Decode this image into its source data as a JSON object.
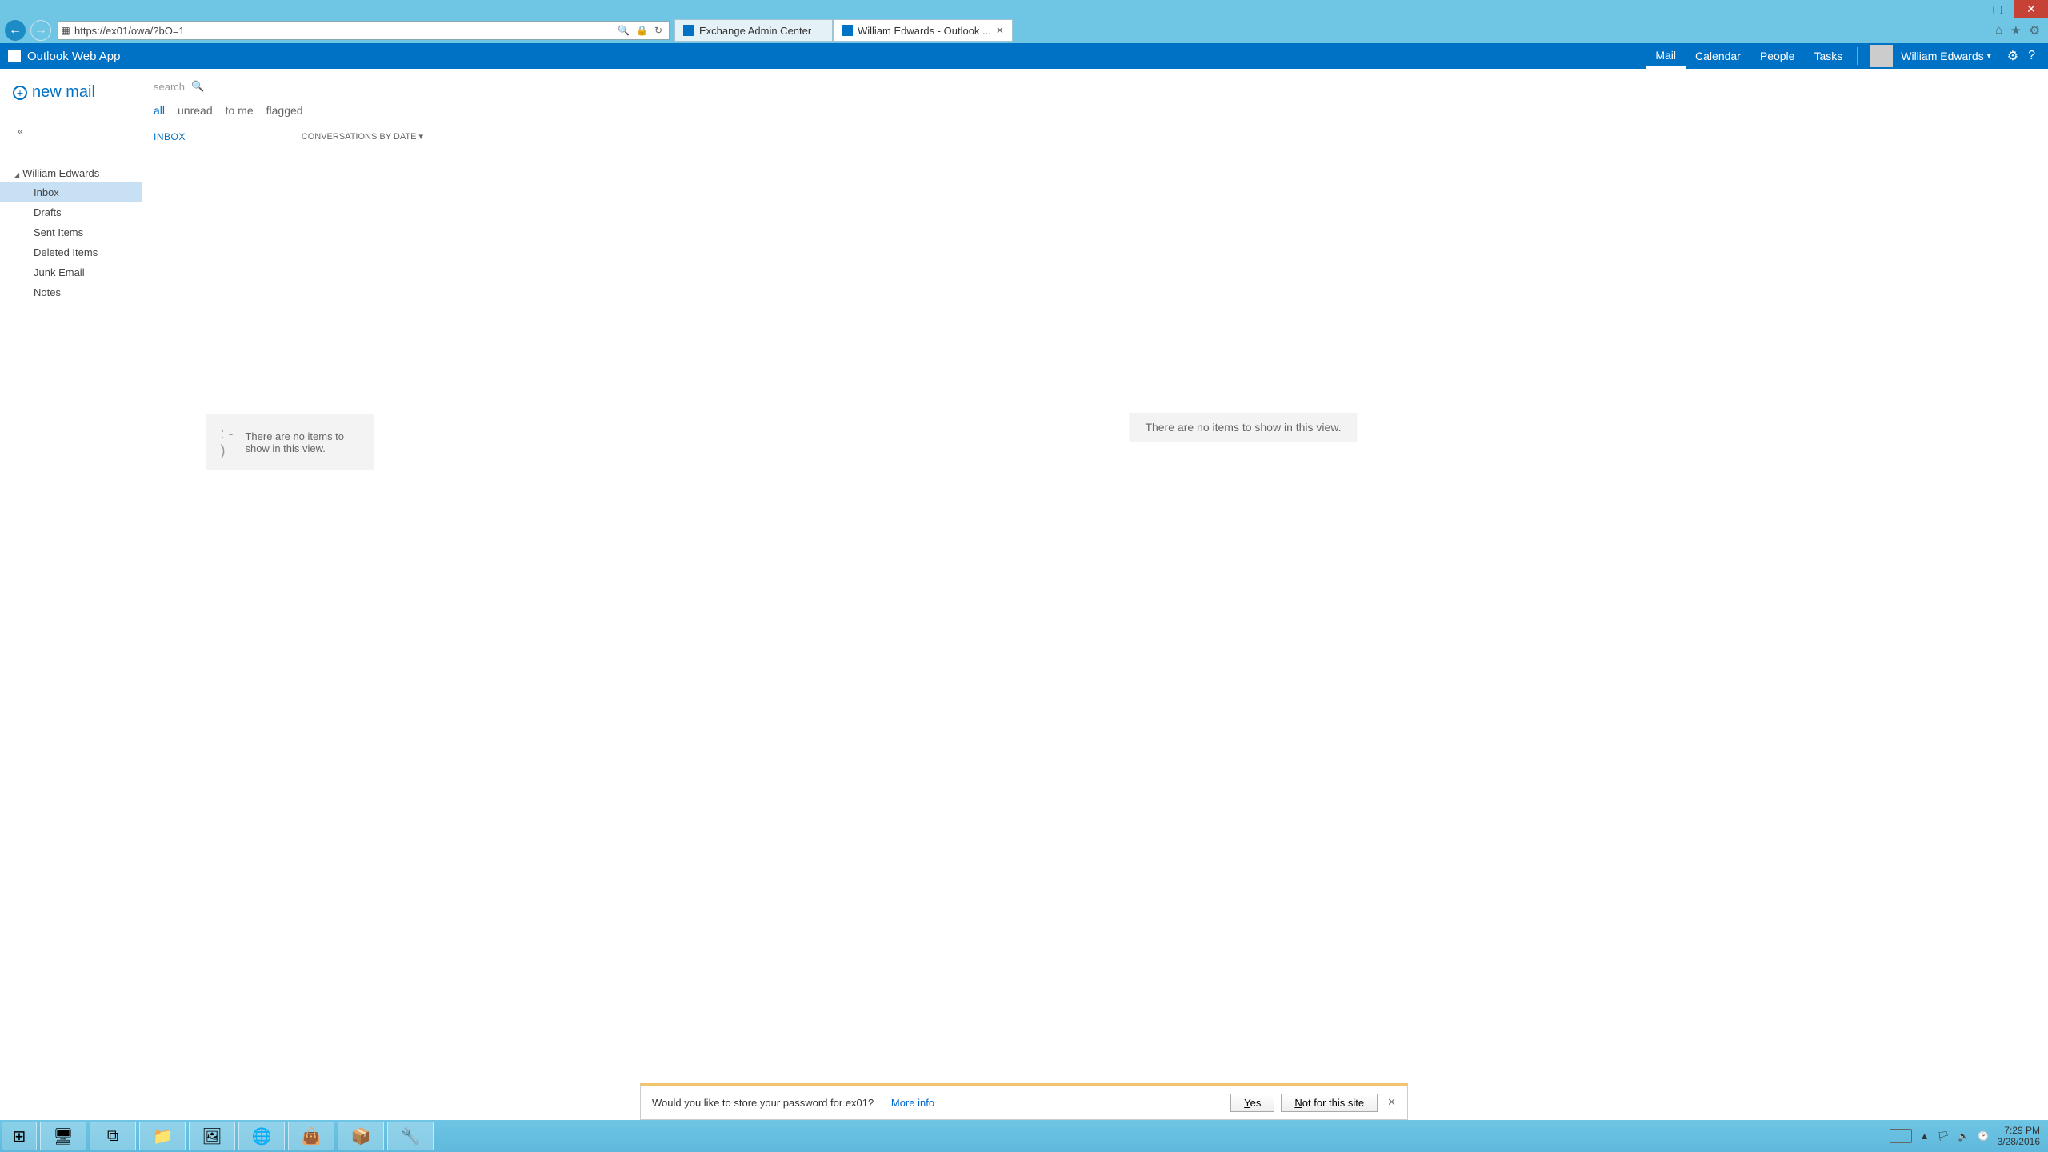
{
  "window": {
    "min": "—",
    "max": "▢",
    "close": "✕"
  },
  "ie": {
    "url": "https://ex01/owa/?bO=1",
    "search_icon": "🔍",
    "lock": "🔒",
    "refresh": "↻",
    "tabs": [
      {
        "title": "Exchange Admin Center",
        "active": false
      },
      {
        "title": "William Edwards - Outlook ...",
        "active": true
      }
    ],
    "home": "⌂",
    "star": "★",
    "gear": "⚙"
  },
  "owa": {
    "title": "Outlook Web App",
    "nav": [
      {
        "label": "Mail",
        "active": true
      },
      {
        "label": "Calendar",
        "active": false
      },
      {
        "label": "People",
        "active": false
      },
      {
        "label": "Tasks",
        "active": false
      }
    ],
    "user": "William Edwards",
    "caret": "▾",
    "gear": "⚙",
    "help": "?"
  },
  "sidebar": {
    "newmail": "new mail",
    "collapse": "«",
    "tree_user": "William Edwards",
    "folders": [
      {
        "name": "Inbox",
        "selected": true
      },
      {
        "name": "Drafts",
        "selected": false
      },
      {
        "name": "Sent Items",
        "selected": false
      },
      {
        "name": "Deleted Items",
        "selected": false
      },
      {
        "name": "Junk Email",
        "selected": false
      },
      {
        "name": "Notes",
        "selected": false
      }
    ]
  },
  "msglist": {
    "search_placeholder": "search",
    "filters": [
      {
        "label": "all",
        "active": true
      },
      {
        "label": "unread",
        "active": false
      },
      {
        "label": "to me",
        "active": false
      },
      {
        "label": "flagged",
        "active": false
      }
    ],
    "folder_label": "INBOX",
    "sort_label": "CONVERSATIONS BY DATE ▾",
    "empty_face": ": - )",
    "empty_text": "There are no items to show in this view."
  },
  "reading": {
    "empty": "There are no items to show in this view."
  },
  "notif": {
    "text": "Would you like to store your password for ex01?",
    "more": "More info",
    "yes": "Yes",
    "no": "Not for this site",
    "close": "✕"
  },
  "taskbar": {
    "buttons": [
      "⊞",
      "🖥",
      "⧉",
      "📁",
      "🖼",
      "🌐",
      "👜",
      "📦",
      "🔧"
    ],
    "tray_icons": [
      "▲",
      "🏳",
      "🔈",
      "🕑"
    ],
    "time": "7:29 PM",
    "date": "3/28/2016"
  }
}
